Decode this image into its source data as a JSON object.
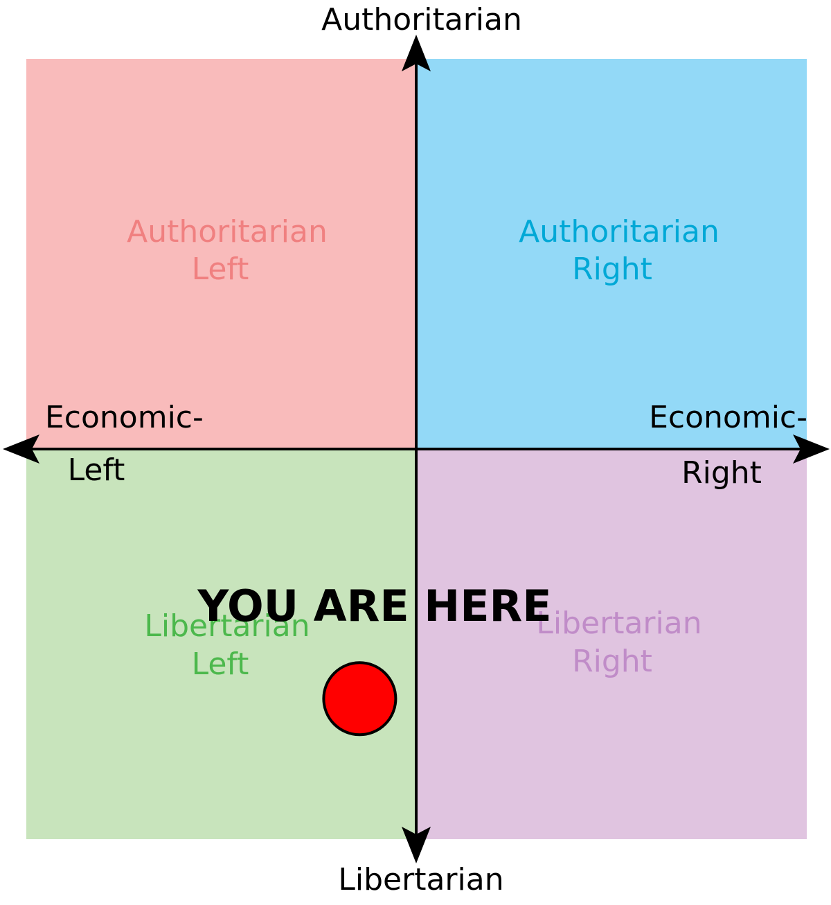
{
  "axes": {
    "top_label": "Authoritarian",
    "bottom_label": "Libertarian",
    "left_label_line1": "Economic-",
    "left_label_line2": "Left",
    "right_label_line1": "Economic-",
    "right_label_line2": "Right"
  },
  "quadrants": {
    "auth_left": {
      "line1": "Authoritarian",
      "line2": "Left",
      "fill": "#f9bbbb",
      "text_color": "#f08080"
    },
    "auth_right": {
      "line1": "Authoritarian",
      "line2": "Right",
      "fill": "#93d9f7",
      "text_color": "#00a8d6"
    },
    "lib_left": {
      "line1": "Libertarian",
      "line2": "Left",
      "fill": "#c8e4bc",
      "text_color": "#4cb84c"
    },
    "lib_right": {
      "line1": "Libertarian",
      "line2": "Right",
      "fill": "#e0c4e0",
      "text_color": "#c08cc8"
    }
  },
  "marker": {
    "label": "YOU ARE HERE",
    "x": -1.45,
    "y": -6.4,
    "color": "#ff0000"
  },
  "scale": {
    "min": -10,
    "max": 10
  }
}
